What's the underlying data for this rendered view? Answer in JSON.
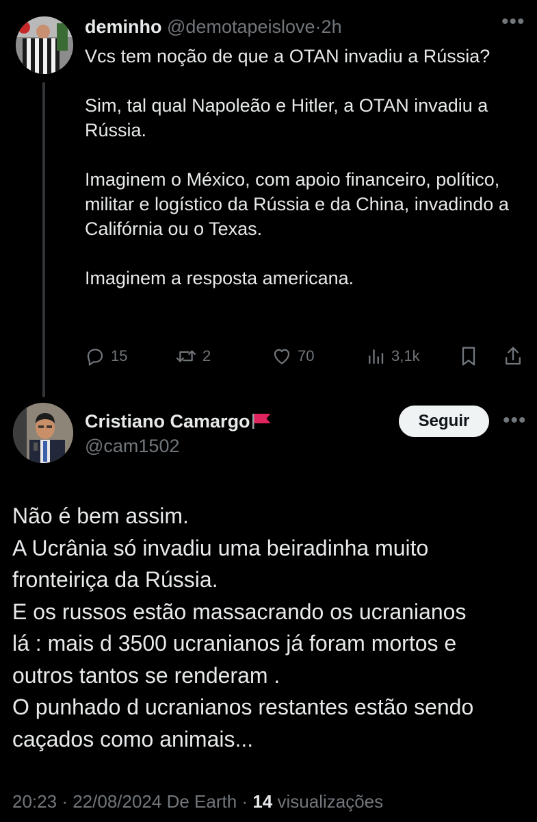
{
  "tweet1": {
    "display_name": "deminho",
    "handle": "@demotapeislove",
    "separator": "·",
    "time": "2h",
    "more_icon": "more-icon",
    "text_paragraphs": [
      "Vcs tem noção de que a OTAN invadiu a Rússia?",
      "Sim, tal qual Napoleão e Hitler, a OTAN invadiu a Rússia.",
      "Imaginem o México, com apoio financeiro, político, militar e logístico da Rússia e da China, invadindo a Califórnia ou o Texas.",
      "Imaginem a resposta americana."
    ],
    "actions": {
      "replies": "15",
      "reposts": "2",
      "likes": "70",
      "views": "3,1k"
    }
  },
  "tweet2": {
    "display_name": "Cristiano Camargo",
    "flag_emoji_icon": "red-flag-icon",
    "handle": "@cam1502",
    "follow_label": "Seguir",
    "text_lines": [
      "Não é bem assim.",
      "A Ucrânia só invadiu uma beiradinha muito",
      "fronteiriça da Rússia.",
      "E os russos estão massacrando os ucranianos",
      "lá : mais d 3500 ucranianos já foram mortos e",
      "outros tantos se renderam .",
      "O punhado d ucranianos restantes estão sendo",
      "caçados como animais..."
    ],
    "meta": {
      "time": "20:23",
      "separator": "·",
      "date": "22/08/2024",
      "source": "De Earth",
      "separator2": "·",
      "views_count": "14",
      "views_label": "visualizações"
    }
  },
  "colors": {
    "background": "#000000",
    "text": "#e7e9ea",
    "muted": "#71767b",
    "button_bg": "#eff3f4",
    "flag_red": "#e0245e"
  }
}
